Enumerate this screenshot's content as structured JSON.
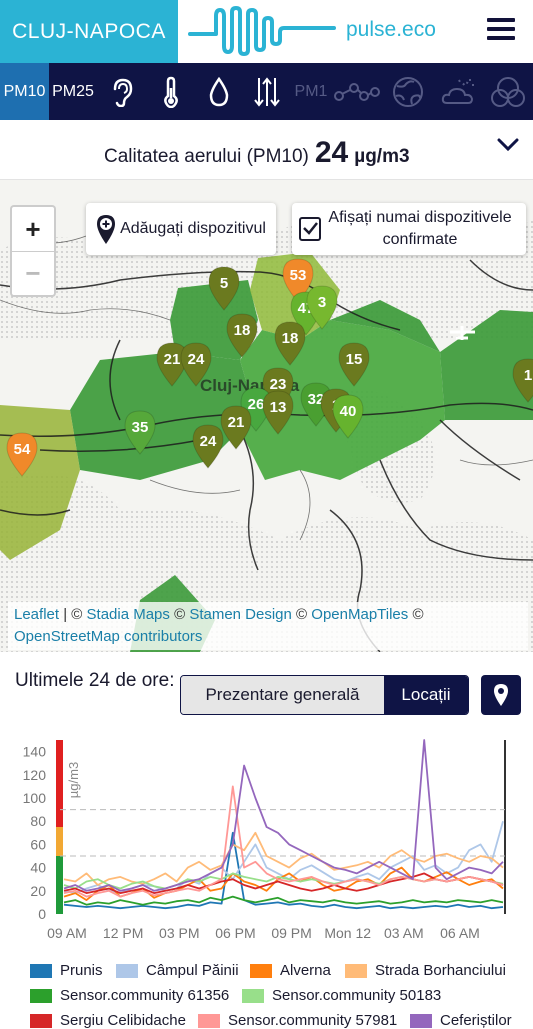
{
  "header": {
    "city": "CLUJ-NAPOCA",
    "brand": "pulse.eco",
    "accent": "#2bb3d4",
    "navy": "#0f1445"
  },
  "pollutant_tabs": [
    {
      "label": "PM10",
      "active": true
    },
    {
      "label": "PM25",
      "active": false
    },
    {
      "icon": "ear-icon"
    },
    {
      "icon": "thermometer-icon"
    },
    {
      "icon": "droplet-icon"
    },
    {
      "icon": "pressure-arrows-icon"
    },
    {
      "label": "PM1",
      "dim": true
    },
    {
      "icon": "molecule-icon",
      "dim": true
    },
    {
      "icon": "globe-icon",
      "dim": true
    },
    {
      "icon": "cloud-sun-icon",
      "dim": true
    },
    {
      "icon": "circles-icon",
      "dim": true
    }
  ],
  "quality": {
    "label": "Calitatea aerului (PM10)",
    "value": "24",
    "unit": "µg/m3"
  },
  "map": {
    "zoom_in": "+",
    "zoom_out": "−",
    "add_device": "Adăugați dispozitivul",
    "confirmed_only": "Afișați numai dispozitivele confirmate",
    "city_label": "Cluj-Napoca",
    "markers": [
      "5",
      "53",
      "47",
      "3",
      "18",
      "18",
      "21",
      "24",
      "15",
      "23",
      "26",
      "13",
      "32",
      "1",
      "40",
      "35",
      "21",
      "24",
      "54",
      "1"
    ],
    "attribution": {
      "leaflet": "Leaflet",
      "sep1": "| ©",
      "stadia": "Stadia Maps",
      "c2": "©",
      "stamen": "Stamen Design",
      "c3": "©",
      "omt": "OpenMapTiles",
      "c4": "©",
      "osm": "OpenStreetMap contributors"
    }
  },
  "history": {
    "title": "Ultimele 24 de ore:",
    "tab_overview": "Prezentare generală",
    "tab_locations": "Locații"
  },
  "chart_data": {
    "type": "line",
    "ylabel": "µg/m3",
    "ylim": [
      0,
      150
    ],
    "yticks": [
      "0",
      "20",
      "40",
      "60",
      "80",
      "100",
      "120",
      "140"
    ],
    "xticks": [
      "09 AM",
      "12 PM",
      "03 PM",
      "06 PM",
      "09 PM",
      "Mon 12",
      "03 AM",
      "06 AM"
    ],
    "thresholds": [
      50,
      90
    ],
    "series": [
      {
        "name": "Prunis",
        "color": "#1f77b4",
        "values": [
          8,
          7,
          6,
          7,
          6,
          5,
          6,
          7,
          6,
          5,
          6,
          8,
          7,
          10,
          9,
          70,
          12,
          8,
          9,
          10,
          8,
          9,
          7,
          6,
          8,
          6,
          5,
          6,
          7,
          5,
          6,
          5,
          6,
          7,
          6,
          8,
          6,
          7,
          5,
          6
        ]
      },
      {
        "name": "Câmpul Păinii",
        "color": "#aec7e8",
        "values": [
          20,
          18,
          22,
          25,
          20,
          18,
          22,
          25,
          24,
          20,
          22,
          30,
          26,
          35,
          40,
          30,
          45,
          60,
          40,
          35,
          30,
          38,
          42,
          36,
          30,
          28,
          32,
          35,
          30,
          40,
          45,
          50,
          38,
          42,
          35,
          40,
          55,
          60,
          45,
          80
        ]
      },
      {
        "name": "Alverna",
        "color": "#ff7f0e",
        "values": [
          15,
          18,
          12,
          20,
          25,
          15,
          18,
          22,
          14,
          18,
          20,
          25,
          30,
          20,
          22,
          35,
          28,
          25,
          20,
          30,
          35,
          28,
          32,
          25,
          20,
          22,
          28,
          30,
          25,
          35,
          40,
          30,
          28,
          32,
          36,
          30,
          25,
          28,
          30,
          22
        ]
      },
      {
        "name": "Strada Borhanciului",
        "color": "#ffbb78",
        "values": [
          30,
          28,
          35,
          25,
          30,
          32,
          28,
          26,
          30,
          35,
          28,
          40,
          45,
          38,
          42,
          60,
          55,
          70,
          50,
          45,
          40,
          48,
          52,
          45,
          38,
          40,
          42,
          45,
          40,
          50,
          55,
          48,
          45,
          50,
          52,
          48,
          45,
          50,
          48,
          40
        ]
      },
      {
        "name": "Sensor.community 61356",
        "color": "#2ca02c",
        "values": [
          10,
          12,
          8,
          10,
          9,
          12,
          10,
          8,
          10,
          9,
          11,
          12,
          10,
          14,
          12,
          15,
          12,
          10,
          12,
          14,
          10,
          12,
          11,
          10,
          12,
          10,
          9,
          10,
          11,
          9,
          10,
          12,
          10,
          11,
          10,
          12,
          11,
          10,
          12,
          10
        ]
      },
      {
        "name": "Sensor.community 50183",
        "color": "#98df8a",
        "values": [
          25,
          22,
          28,
          30,
          25,
          22,
          26,
          28,
          24,
          22,
          25,
          30,
          28,
          32,
          30,
          35,
          32,
          30,
          28,
          32,
          30,
          28,
          30,
          28,
          26,
          28,
          30,
          28,
          26,
          30,
          32,
          30,
          28,
          30,
          28,
          30,
          32,
          30,
          28,
          26
        ]
      },
      {
        "name": "Sergiu Celibidache",
        "color": "#d62728",
        "values": [
          20,
          22,
          18,
          20,
          22,
          18,
          20,
          22,
          18,
          20,
          22,
          25,
          22,
          25,
          28,
          30,
          25,
          22,
          25,
          28,
          25,
          22,
          20,
          22,
          25,
          22,
          20,
          22,
          25,
          28,
          30,
          32,
          35,
          30,
          28,
          30,
          32,
          30,
          28,
          25
        ]
      },
      {
        "name": "Sensor.community 57981",
        "color": "#ff9896",
        "values": [
          18,
          20,
          15,
          18,
          20,
          15,
          18,
          20,
          16,
          18,
          20,
          22,
          20,
          25,
          30,
          110,
          40,
          45,
          35,
          30,
          28,
          30,
          32,
          28,
          25,
          28,
          30,
          28,
          25,
          30,
          32,
          30,
          28,
          30,
          28,
          30,
          32,
          30,
          28,
          25
        ]
      },
      {
        "name": "Ceferiștilor",
        "color": "#9467bd",
        "values": [
          22,
          25,
          20,
          22,
          25,
          20,
          22,
          25,
          20,
          22,
          25,
          28,
          30,
          35,
          40,
          60,
          128,
          100,
          75,
          70,
          60,
          55,
          50,
          45,
          40,
          38,
          35,
          40,
          45,
          40,
          35,
          30,
          155,
          40,
          30,
          35,
          40,
          38,
          35,
          45
        ]
      }
    ]
  }
}
